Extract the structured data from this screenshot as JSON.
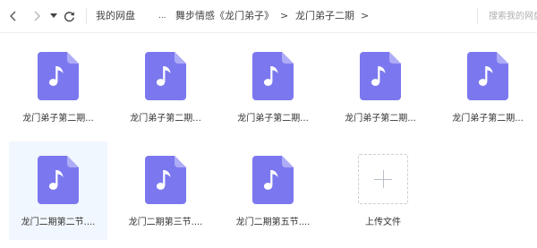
{
  "nav": {
    "back_icon": "chevron-left",
    "forward_icon": "chevron-right",
    "history_icon": "caret-down",
    "refresh_icon": "refresh"
  },
  "breadcrumb": {
    "items": [
      "我的网盘",
      "...",
      "舞步情感《龙门弟子》",
      "龙门弟子二期"
    ],
    "separator": ">"
  },
  "search": {
    "placeholder": "搜索我的网盘"
  },
  "files": [
    {
      "name": "龙门弟子第二期...",
      "icon": "music-file-icon"
    },
    {
      "name": "龙门弟子第二期...",
      "icon": "music-file-icon"
    },
    {
      "name": "龙门弟子第二期...",
      "icon": "music-file-icon"
    },
    {
      "name": "龙门弟子第二期...",
      "icon": "music-file-icon"
    },
    {
      "name": "龙门弟子第二期...",
      "icon": "music-file-icon"
    },
    {
      "name": "龙门二期第二节....",
      "icon": "music-file-icon"
    },
    {
      "name": "龙门二期第三节....",
      "icon": "music-file-icon"
    },
    {
      "name": "龙门二期第五节....",
      "icon": "music-file-icon"
    }
  ],
  "upload": {
    "label": "上传文件",
    "icon": "plus-icon"
  },
  "colors": {
    "file_icon": "#7b78ef",
    "file_icon_fold": "#aeacf6",
    "selected_tile": "#f1f7fe"
  }
}
